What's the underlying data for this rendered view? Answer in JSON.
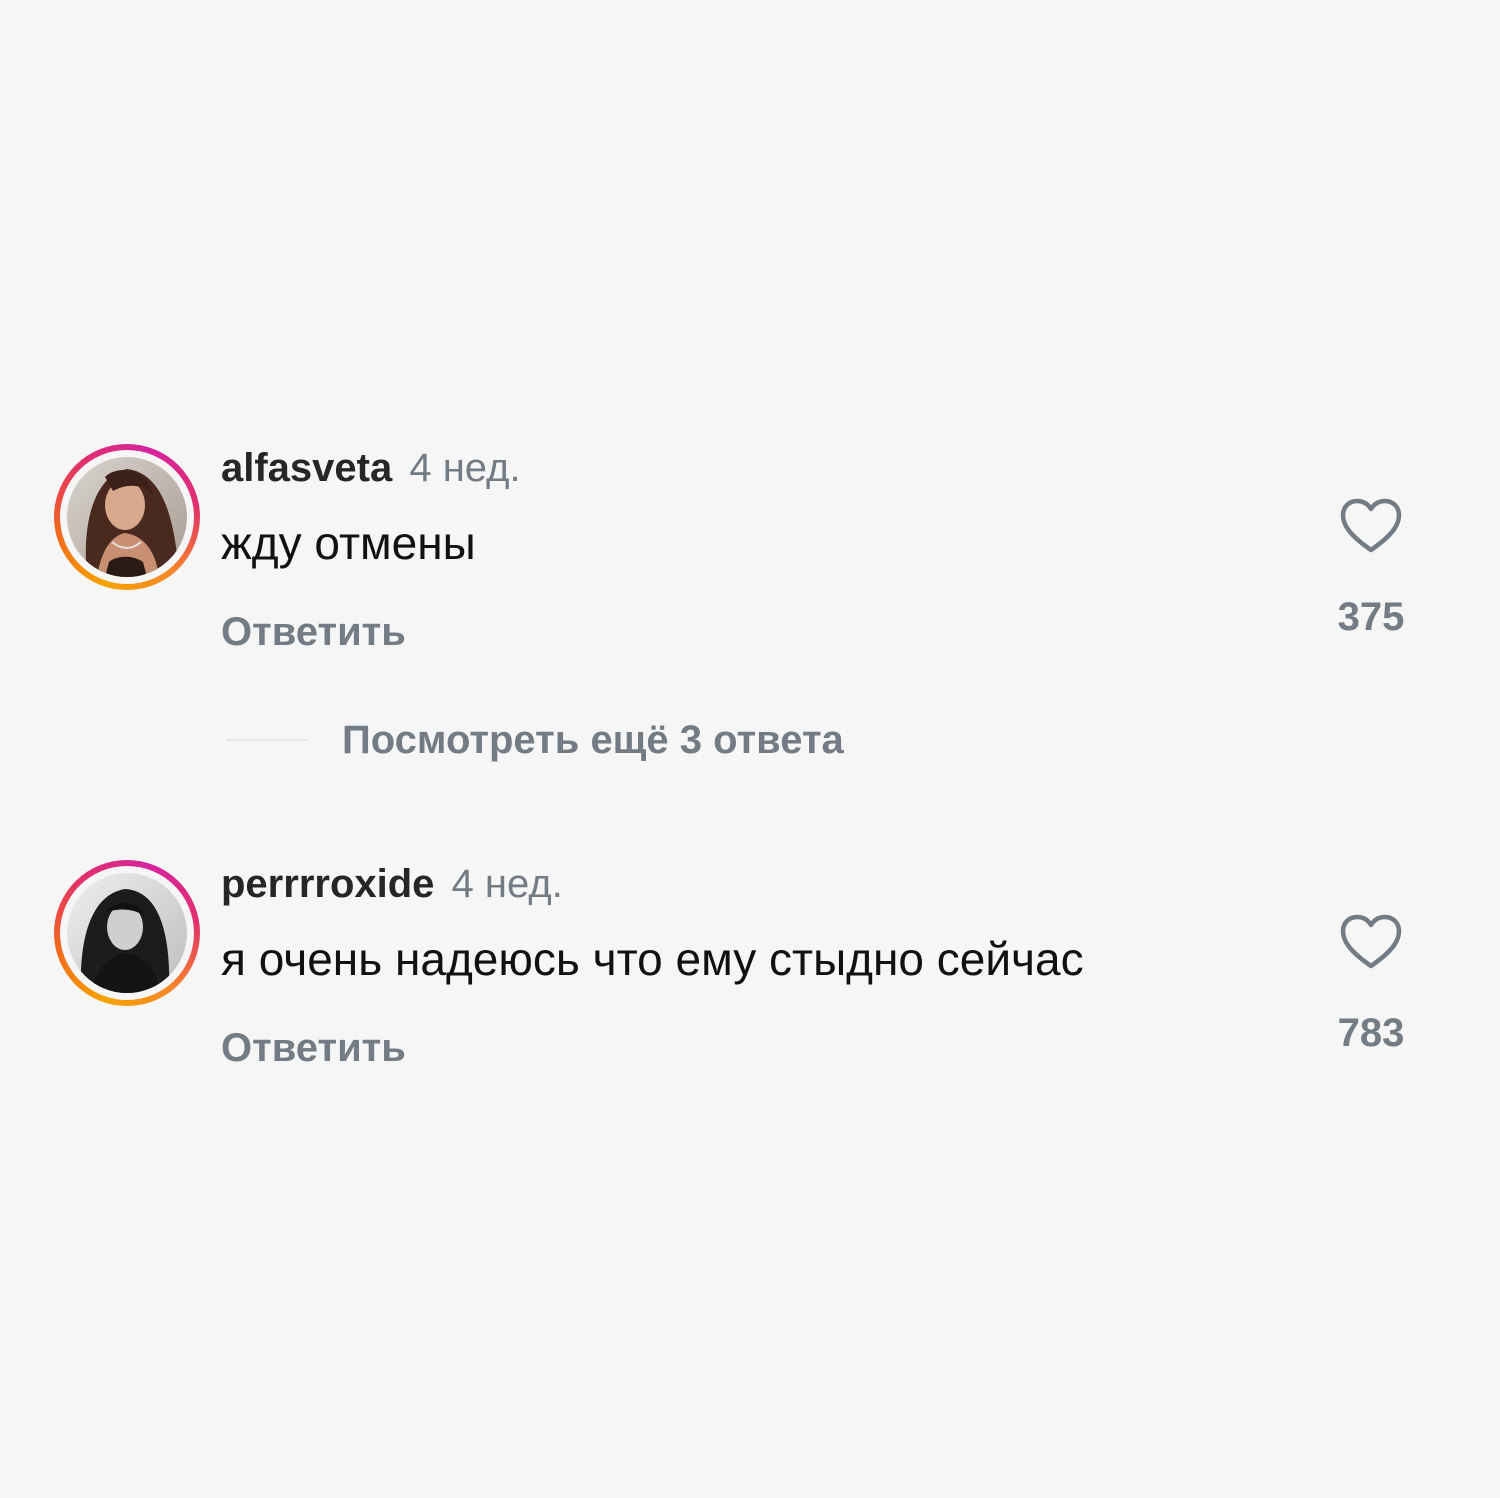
{
  "comments": [
    {
      "username": "alfasveta",
      "time": "4 нед.",
      "text": "жду отмены",
      "reply_label": "Ответить",
      "likes": "375"
    },
    {
      "username": "perrrroxide",
      "time": "4 нед.",
      "text": "я очень надеюсь что ему стыдно сейчас",
      "reply_label": "Ответить",
      "likes": "783"
    }
  ],
  "view_replies": "Посмотреть ещё 3 ответа",
  "icons": {
    "like": "heart-icon",
    "story_ring": "story-ring"
  },
  "colors": {
    "background": "#f6f6f6",
    "secondary_text": "#737b84",
    "username": "#262626",
    "ring_start": "#f5a400",
    "ring_end": "#d6249f"
  }
}
